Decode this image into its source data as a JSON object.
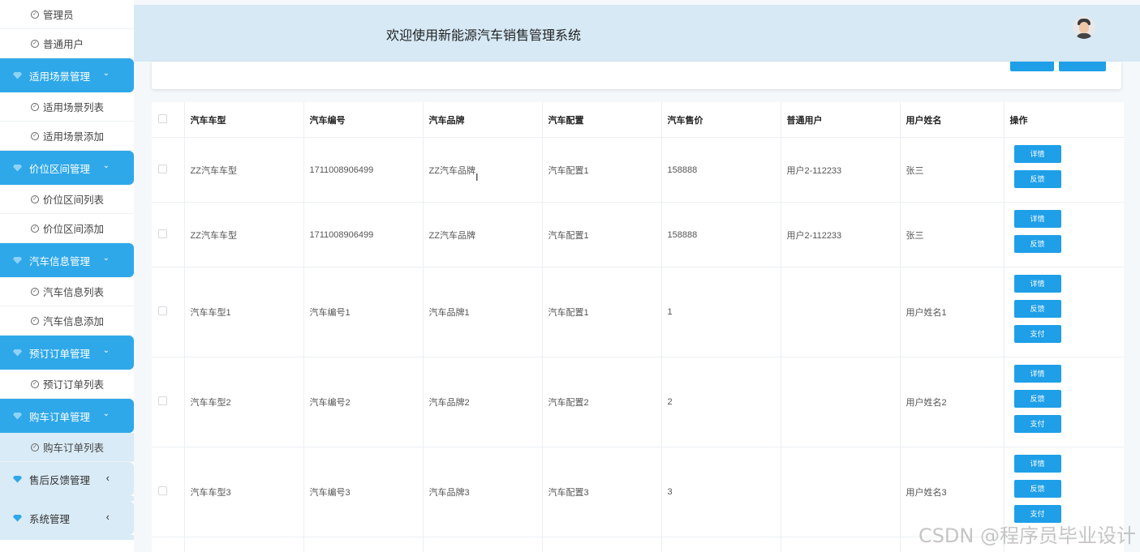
{
  "sidebar": {
    "items": [
      {
        "type": "sub",
        "label": "管理员"
      },
      {
        "type": "sub",
        "label": "普通用户"
      },
      {
        "type": "group",
        "label": "适用场景管理",
        "caret": "⌄"
      },
      {
        "type": "sub",
        "label": "适用场景列表"
      },
      {
        "type": "sub",
        "label": "适用场景添加"
      },
      {
        "type": "group",
        "label": "价位区间管理",
        "caret": "⌄"
      },
      {
        "type": "sub",
        "label": "价位区间列表"
      },
      {
        "type": "sub",
        "label": "价位区间添加"
      },
      {
        "type": "group",
        "label": "汽车信息管理",
        "caret": "⌄"
      },
      {
        "type": "sub",
        "label": "汽车信息列表"
      },
      {
        "type": "sub",
        "label": "汽车信息添加"
      },
      {
        "type": "group",
        "label": "预订订单管理",
        "caret": "⌄"
      },
      {
        "type": "sub",
        "label": "预订订单列表"
      },
      {
        "type": "group",
        "label": "购车订单管理",
        "caret": "⌄"
      },
      {
        "type": "sub",
        "label": "购车订单列表"
      },
      {
        "type": "group-collapsed",
        "label": "售后反馈管理",
        "caret": "‹"
      },
      {
        "type": "group-collapsed",
        "label": "系统管理",
        "caret": "‹"
      }
    ]
  },
  "header": {
    "welcome": "欢迎使用新能源汽车销售管理系统"
  },
  "table": {
    "columns": [
      "汽车车型",
      "汽车编号",
      "汽车品牌",
      "汽车配置",
      "汽车售价",
      "普通用户",
      "用户姓名",
      "操作"
    ],
    "rows": [
      {
        "cells": [
          "ZZ汽车车型",
          "1711008906499",
          "ZZ汽车品牌",
          "汽车配置1",
          "158888",
          "用户2-112233",
          "张三"
        ],
        "actions": [
          "详情",
          "反馈"
        ]
      },
      {
        "cells": [
          "ZZ汽车车型",
          "1711008906499",
          "ZZ汽车品牌",
          "汽车配置1",
          "158888",
          "用户2-112233",
          "张三"
        ],
        "actions": [
          "详情",
          "反馈"
        ]
      },
      {
        "cells": [
          "汽车车型1",
          "汽车编号1",
          "汽车品牌1",
          "汽车配置1",
          "1",
          "",
          "用户姓名1"
        ],
        "actions": [
          "详情",
          "反馈",
          "支付"
        ]
      },
      {
        "cells": [
          "汽车车型2",
          "汽车编号2",
          "汽车品牌2",
          "汽车配置2",
          "2",
          "",
          "用户姓名2"
        ],
        "actions": [
          "详情",
          "反馈",
          "支付"
        ]
      },
      {
        "cells": [
          "汽车车型3",
          "汽车编号3",
          "汽车品牌3",
          "汽车配置3",
          "3",
          "",
          "用户姓名3"
        ],
        "actions": [
          "详情",
          "反馈",
          "支付"
        ]
      }
    ]
  },
  "watermark": "CSDN @程序员毕业设计",
  "colors": {
    "accent": "#2fa8ea",
    "header_bg": "#d6e9f5",
    "button": "#1e9fe8"
  }
}
